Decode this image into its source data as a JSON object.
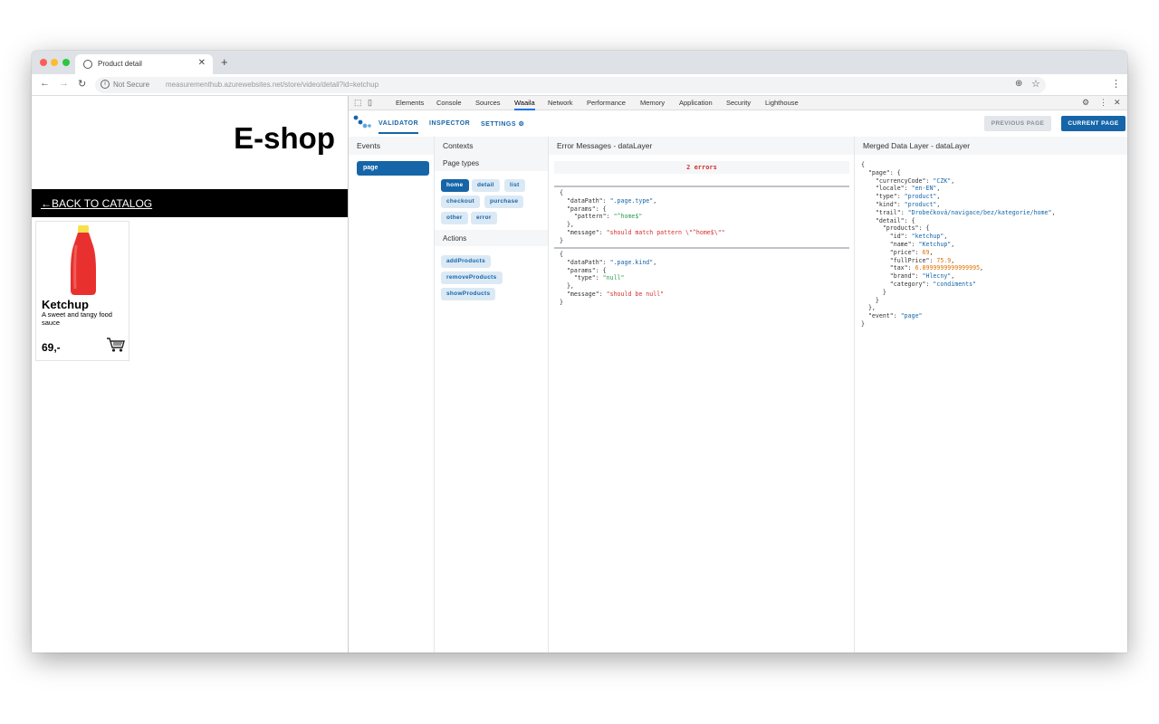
{
  "browser": {
    "tab_title": "Product detail",
    "not_secure": "Not Secure",
    "url": "measurementhub.azurewebsites.net/store/video/detail?id=ketchup"
  },
  "shop": {
    "title": "E-shop",
    "back_link": "←BACK TO CATALOG",
    "product": {
      "name": "Ketchup",
      "description": "A sweet and tangy food sauce",
      "price": "69,-"
    }
  },
  "devtools": {
    "tabs": [
      "Elements",
      "Console",
      "Sources",
      "Waaila",
      "Network",
      "Performance",
      "Memory",
      "Application",
      "Security",
      "Lighthouse"
    ],
    "active_tab": "Waaila"
  },
  "waaila": {
    "tabs": {
      "validator": "VALIDATOR",
      "inspector": "INSPECTOR",
      "settings": "SETTINGS"
    },
    "previous_page": "PREVIOUS PAGE",
    "current_page": "CURRENT PAGE",
    "events": {
      "header": "Events",
      "items": [
        "page"
      ]
    },
    "contexts": {
      "header": "Contexts",
      "page_types_header": "Page types",
      "page_types": [
        "home",
        "detail",
        "list",
        "checkout",
        "purchase",
        "other",
        "error"
      ],
      "selected_page_type": "home",
      "actions_header": "Actions",
      "actions": [
        "addProducts",
        "removeProducts",
        "showProducts"
      ]
    },
    "errors": {
      "header": "Error Messages - dataLayer",
      "count": "2 errors",
      "items": [
        {
          "dataPath": "\".page.type\"",
          "param_key": "\"pattern\"",
          "param_value": "\"^home$\"",
          "message": "\"should match pattern \\\"^home$\\\"\""
        },
        {
          "dataPath": "\".page.kind\"",
          "param_key": "\"type\"",
          "param_value": "\"null\"",
          "message": "\"should be null\""
        }
      ]
    },
    "merged": {
      "header": "Merged Data Layer - dataLayer",
      "currencyCode": "\"CZK\"",
      "locale": "\"en-EN\"",
      "type": "\"product\"",
      "kind": "\"product\"",
      "trail": "\"Drobečková/navigace/bez/kategorie/home\"",
      "id": "\"ketchup\"",
      "name": "\"Ketchup\"",
      "price": "69",
      "fullPrice": "75.9",
      "tax": "6.8999999999999995",
      "brand": "\"Hlecny\"",
      "category": "\"condiments\"",
      "event": "\"page\""
    }
  }
}
